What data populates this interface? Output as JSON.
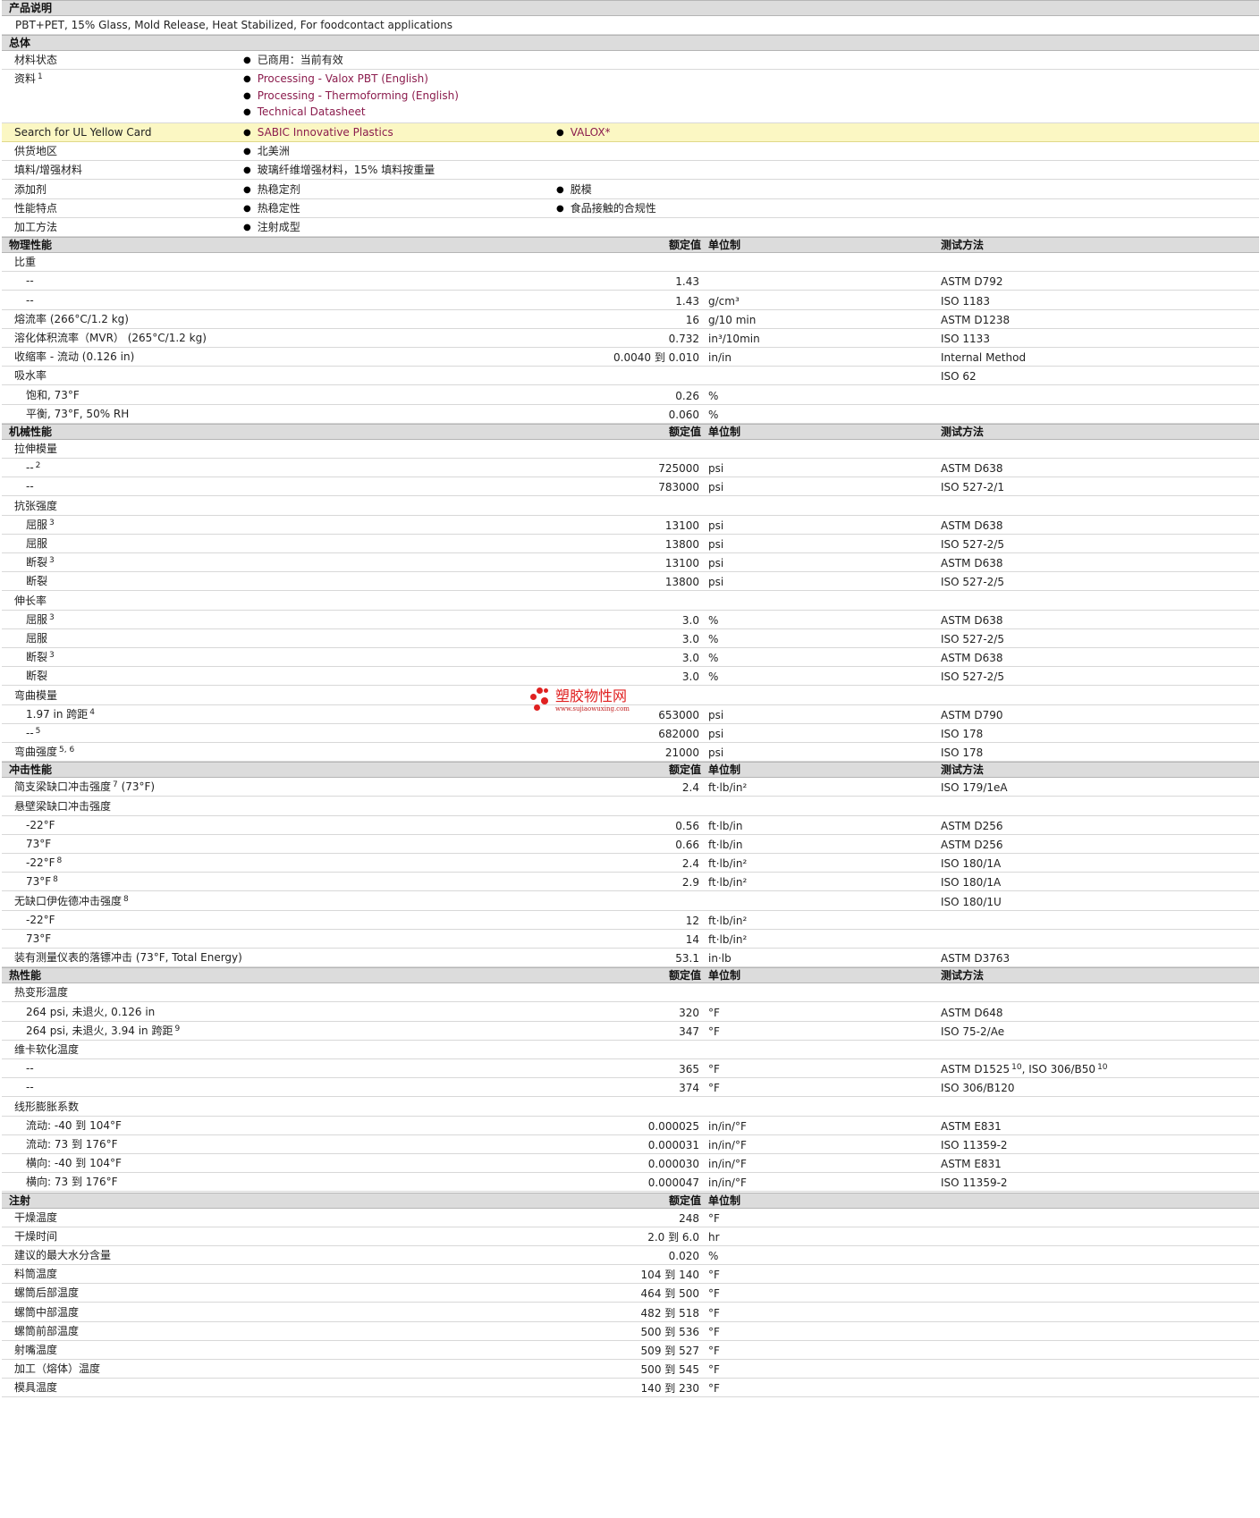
{
  "description": {
    "header": "产品说明",
    "text": "PBT+PET, 15% Glass, Mold Release, Heat Stabilized, For foodcontact applications"
  },
  "general": {
    "header": "总体",
    "rows": [
      {
        "label": "材料状态",
        "items": [
          "已商用：当前有效"
        ]
      },
      {
        "label": "资料",
        "sup": "1",
        "items": [
          "Processing - Valox PBT (English)",
          "Processing - Thermoforming (English)",
          "Technical Datasheet"
        ],
        "links": true
      },
      {
        "label": "Search for UL Yellow Card",
        "items": [
          "SABIC Innovative Plastics",
          "VALOX*"
        ],
        "links": true,
        "highlight": true
      },
      {
        "label": "供货地区",
        "items": [
          "北美洲"
        ]
      },
      {
        "label": "填料/增强材料",
        "items": [
          "玻璃纤维增强材料，15% 填料按重量"
        ]
      },
      {
        "label": "添加剂",
        "items": [
          "热稳定剂",
          "脱模"
        ]
      },
      {
        "label": "性能特点",
        "items": [
          "热稳定性",
          "食品接触的合规性"
        ]
      },
      {
        "label": "加工方法",
        "items": [
          "注射成型"
        ]
      }
    ]
  },
  "column_headers": {
    "value": "额定值",
    "unit": "单位制",
    "method": "测试方法"
  },
  "sections": [
    {
      "title": "物理性能",
      "show_method": true,
      "rows": [
        {
          "label": "比重"
        },
        {
          "label": "--",
          "indent": true,
          "value": "1.43",
          "method": "ASTM D792"
        },
        {
          "label": "--",
          "indent": true,
          "value": "1.43",
          "unit": "g/cm³",
          "method": "ISO 1183"
        },
        {
          "label": "熔流率 (266°C/1.2 kg)",
          "value": "16",
          "unit": "g/10 min",
          "method": "ASTM D1238"
        },
        {
          "label": "溶化体积流率（MVR） (265°C/1.2 kg)",
          "value": "0.732",
          "unit": "in³/10min",
          "method": "ISO 1133"
        },
        {
          "label": "收缩率 - 流动 (0.126 in)",
          "value": "0.0040 到  0.010",
          "unit": "in/in",
          "method": "Internal Method"
        },
        {
          "label": "吸水率",
          "method": "ISO 62"
        },
        {
          "label": "饱和, 73°F",
          "indent": true,
          "value": "0.26",
          "unit": "%"
        },
        {
          "label": "平衡, 73°F, 50% RH",
          "indent": true,
          "value": "0.060",
          "unit": "%"
        }
      ]
    },
    {
      "title": "机械性能",
      "show_method": true,
      "rows": [
        {
          "label": "拉伸模量"
        },
        {
          "label": "--",
          "sup": "2",
          "indent": true,
          "value": "725000",
          "unit": "psi",
          "method": "ASTM D638"
        },
        {
          "label": "--",
          "indent": true,
          "value": "783000",
          "unit": "psi",
          "method": "ISO 527-2/1"
        },
        {
          "label": "抗张强度"
        },
        {
          "label": "屈服",
          "sup": "3",
          "indent": true,
          "value": "13100",
          "unit": "psi",
          "method": "ASTM D638"
        },
        {
          "label": "屈服",
          "indent": true,
          "value": "13800",
          "unit": "psi",
          "method": "ISO 527-2/5"
        },
        {
          "label": "断裂",
          "sup": "3",
          "indent": true,
          "value": "13100",
          "unit": "psi",
          "method": "ASTM D638"
        },
        {
          "label": "断裂",
          "indent": true,
          "value": "13800",
          "unit": "psi",
          "method": "ISO 527-2/5"
        },
        {
          "label": "伸长率"
        },
        {
          "label": "屈服",
          "sup": "3",
          "indent": true,
          "value": "3.0",
          "unit": "%",
          "method": "ASTM D638"
        },
        {
          "label": "屈服",
          "indent": true,
          "value": "3.0",
          "unit": "%",
          "method": "ISO 527-2/5"
        },
        {
          "label": "断裂",
          "sup": "3",
          "indent": true,
          "value": "3.0",
          "unit": "%",
          "method": "ASTM D638"
        },
        {
          "label": "断裂",
          "indent": true,
          "value": "3.0",
          "unit": "%",
          "method": "ISO 527-2/5"
        },
        {
          "label": "弯曲模量"
        },
        {
          "label": "1.97 in 跨距",
          "sup": "4",
          "indent": true,
          "value": "653000",
          "unit": "psi",
          "method": "ASTM D790"
        },
        {
          "label": "--",
          "sup": "5",
          "indent": true,
          "value": "682000",
          "unit": "psi",
          "method": "ISO 178"
        },
        {
          "label": "弯曲强度",
          "sup": "5, 6",
          "value": "21000",
          "unit": "psi",
          "method": "ISO 178"
        }
      ]
    },
    {
      "title": "冲击性能",
      "show_method": true,
      "rows": [
        {
          "label": "简支梁缺口冲击强度",
          "sup": "7",
          "suffix": " (73°F)",
          "value": "2.4",
          "unit": "ft·lb/in²",
          "method": "ISO 179/1eA"
        },
        {
          "label": "悬壁梁缺口冲击强度"
        },
        {
          "label": "-22°F",
          "indent": true,
          "value": "0.56",
          "unit": "ft·lb/in",
          "method": "ASTM D256"
        },
        {
          "label": "73°F",
          "indent": true,
          "value": "0.66",
          "unit": "ft·lb/in",
          "method": "ASTM D256"
        },
        {
          "label": "-22°F",
          "sup": "8",
          "indent": true,
          "value": "2.4",
          "unit": "ft·lb/in²",
          "method": "ISO 180/1A"
        },
        {
          "label": "73°F",
          "sup": "8",
          "indent": true,
          "value": "2.9",
          "unit": "ft·lb/in²",
          "method": "ISO 180/1A"
        },
        {
          "label": "无缺口伊佐德冲击强度",
          "sup": "8",
          "method": "ISO 180/1U"
        },
        {
          "label": "-22°F",
          "indent": true,
          "value": "12",
          "unit": "ft·lb/in²"
        },
        {
          "label": "73°F",
          "indent": true,
          "value": "14",
          "unit": "ft·lb/in²"
        },
        {
          "label": "装有测量仪表的落镖冲击 (73°F, Total Energy)",
          "value": "53.1",
          "unit": "in·lb",
          "method": "ASTM D3763"
        }
      ]
    },
    {
      "title": "热性能",
      "show_method": true,
      "rows": [
        {
          "label": "热变形温度"
        },
        {
          "label": "264 psi, 未退火, 0.126 in",
          "indent": true,
          "value": "320",
          "unit": "°F",
          "method": "ASTM D648"
        },
        {
          "label": "264 psi, 未退火, 3.94 in 跨距",
          "sup": "9",
          "indent": true,
          "value": "347",
          "unit": "°F",
          "method": "ISO 75-2/Ae"
        },
        {
          "label": "维卡软化温度"
        },
        {
          "label": "--",
          "indent": true,
          "value": "365",
          "unit": "°F",
          "method": "ASTM D1525",
          "method_sup": "10",
          "method2": ", ISO 306/B50",
          "method2_sup": "10"
        },
        {
          "label": "--",
          "indent": true,
          "value": "374",
          "unit": "°F",
          "method": "ISO 306/B120"
        },
        {
          "label": "线形膨胀系数"
        },
        {
          "label": "流动: -40 到  104°F",
          "indent": true,
          "value": "0.000025",
          "unit": "in/in/°F",
          "method": "ASTM E831"
        },
        {
          "label": "流动: 73 到  176°F",
          "indent": true,
          "value": "0.000031",
          "unit": "in/in/°F",
          "method": "ISO 11359-2"
        },
        {
          "label": "横向: -40 到  104°F",
          "indent": true,
          "value": "0.000030",
          "unit": "in/in/°F",
          "method": "ASTM E831"
        },
        {
          "label": "横向: 73 到  176°F",
          "indent": true,
          "value": "0.000047",
          "unit": "in/in/°F",
          "method": "ISO 11359-2"
        }
      ]
    },
    {
      "title": "注射",
      "show_method": false,
      "rows": [
        {
          "label": "干燥温度",
          "value": "248",
          "unit": "°F"
        },
        {
          "label": "干燥时间",
          "value": "2.0 到  6.0",
          "unit": "hr"
        },
        {
          "label": "建议的最大水分含量",
          "value": "0.020",
          "unit": "%"
        },
        {
          "label": "料筒温度",
          "value": "104 到  140",
          "unit": "°F"
        },
        {
          "label": "螺筒后部温度",
          "value": "464 到  500",
          "unit": "°F"
        },
        {
          "label": "螺筒中部温度",
          "value": "482 到  518",
          "unit": "°F"
        },
        {
          "label": "螺筒前部温度",
          "value": "500 到  536",
          "unit": "°F"
        },
        {
          "label": "射嘴温度",
          "value": "509 到  527",
          "unit": "°F"
        },
        {
          "label": "加工（熔体）温度",
          "value": "500 到  545",
          "unit": "°F"
        },
        {
          "label": "模具温度",
          "value": "140 到  230",
          "unit": "°F"
        }
      ]
    }
  ],
  "watermark": {
    "text": "塑胶物性网",
    "url": "www.sujiaowuxing.com"
  }
}
